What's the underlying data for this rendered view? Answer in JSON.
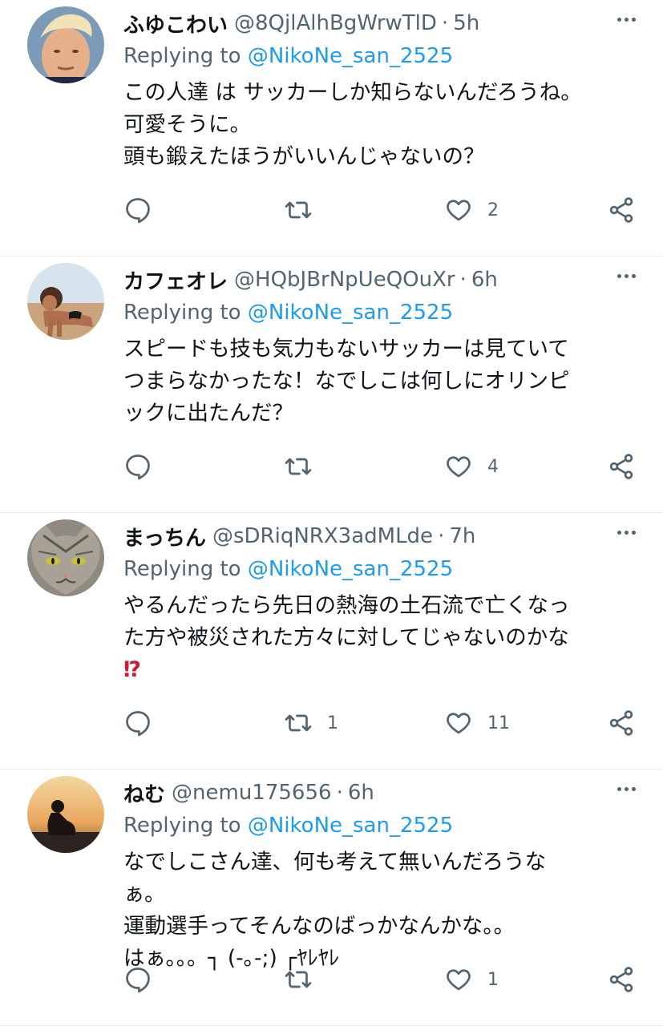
{
  "tweets": [
    {
      "display_name": "ふゆこわい",
      "handle": "@8QjlAlhBgWrwTlD",
      "time": "5h",
      "reply_prefix": "Replying to",
      "reply_mention": "@NikoNe_san_2525",
      "lines": [
        "この人達 は サッカーしか知らないんだろうね。",
        "可愛そうに。",
        "頭も鍛えたほうがいいんじゃないの？"
      ],
      "emoji": "",
      "reply_count": "",
      "retweet_count": "",
      "like_count": "2",
      "avatar": "man-face-avatar"
    },
    {
      "display_name": "カフェオレ",
      "handle": "@HQbJBrNpUeQOuXr",
      "time": "6h",
      "reply_prefix": "Replying to",
      "reply_mention": "@NikoNe_san_2525",
      "lines": [
        "スピードも技も気力もないサッカーは見ていて",
        "つまらなかったな！なでしこは何しにオリンピ",
        "ックに出たんだ？"
      ],
      "emoji": "",
      "reply_count": "",
      "retweet_count": "",
      "like_count": "4",
      "avatar": "beach-woman-avatar"
    },
    {
      "display_name": "まっちん",
      "handle": "@sDRiqNRX3adMLde",
      "time": "7h",
      "reply_prefix": "Replying to",
      "reply_mention": "@NikoNe_san_2525",
      "lines": [
        "やるんだったら先日の熱海の土石流で亡くなっ",
        "た方や被災された方々に対してじゃないのかな"
      ],
      "emoji": "⁉",
      "reply_count": "",
      "retweet_count": "1",
      "like_count": "11",
      "avatar": "cat-avatar"
    },
    {
      "display_name": "ねむ",
      "handle": "@nemu175656",
      "time": "6h",
      "reply_prefix": "Replying to",
      "reply_mention": "@NikoNe_san_2525",
      "lines": [
        "なでしこさん達、何も考えて無いんだろうな",
        "ぁ。",
        "運動選手ってそんなのばっかなんかな。。",
        "はぁ。。。┐ (-｡-;) ┌ﾔﾚﾔﾚ"
      ],
      "emoji": "",
      "reply_count": "",
      "retweet_count": "",
      "like_count": "1",
      "avatar": "sunset-silhouette-avatar"
    }
  ],
  "colors": {
    "text": "#0f1419",
    "secondary": "#536471",
    "link": "#1d9bf0",
    "divider": "#e6ecf0"
  }
}
